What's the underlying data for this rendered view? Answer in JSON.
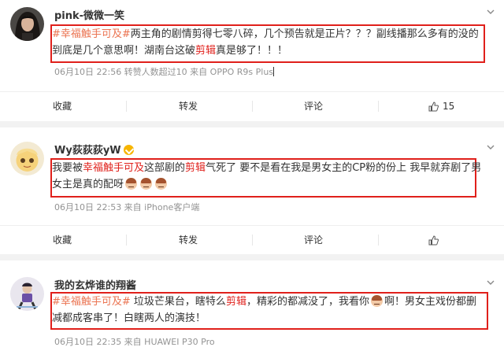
{
  "posts": [
    {
      "username": "pink-微微一笑",
      "content": {
        "topic": "#幸福触手可及#",
        "text1": "两主角的剧情剪得七零八碎，几个预告就是正片？？？副线播那么多有的没的到底是几个意思啊！湖南台这破",
        "red1": "剪辑",
        "text2": "真是够了！！！"
      },
      "meta": "06月10日 22:56 转赞人数超过10  来自 OPPO R9s Plus",
      "actions": {
        "fav": "收藏",
        "forward": "转发",
        "comment": "评论",
        "likes": "15"
      }
    },
    {
      "username": "Wy荻荻荻yW",
      "content": {
        "text1": "我要被",
        "topic": "幸福触手可及",
        "text2": "这部剧的",
        "red1": "剪辑",
        "text3": "气死了 要不是看在我是男女主的CP粉的份上 我早就弃剧了男女主是真的配呀"
      },
      "meta": "06月10日 22:53 来自 iPhone客户端",
      "actions": {
        "fav": "收藏",
        "forward": "转发",
        "comment": "评论",
        "likes": ""
      }
    },
    {
      "username": "我的玄烨谁的翔酱",
      "content": {
        "topic": "#幸福触手可及#",
        "text1": " 垃圾芒果台，瞎特么",
        "red1": "剪辑",
        "text2": "，精彩的都减没了，我看你",
        "text3": "啊！男女主戏份都删减都成客串了！白瞎两人的演技！"
      },
      "meta": "06月10日 22:35 来自 HUAWEI P30 Pro"
    }
  ],
  "colors": {
    "highlight_border": "#e0201b",
    "topic": "#eb7350",
    "meta": "#939393"
  }
}
